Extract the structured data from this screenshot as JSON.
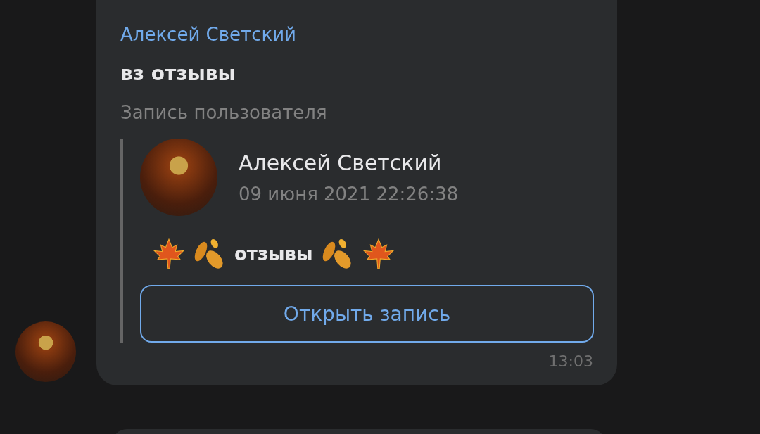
{
  "message": {
    "sender": "Алексей Светский",
    "text": "вз отзывы",
    "attachment_label": "Запись пользователя",
    "post": {
      "author": "Алексей Светский",
      "date": "09 июня 2021 22:26:38",
      "text": "отзывы",
      "button": "Открыть запись"
    },
    "time": "13:03"
  }
}
